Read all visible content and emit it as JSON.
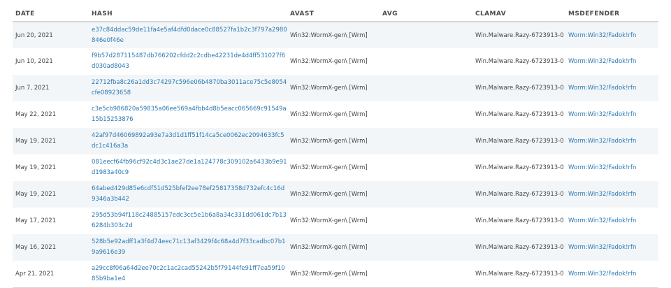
{
  "headers": {
    "date": "DATE",
    "hash": "HASH",
    "avast": "AVAST",
    "avg": "AVG",
    "clamav": "CLAMAV",
    "msdefender": "MSDEFENDER"
  },
  "rows": [
    {
      "date": "Jun 20, 2021",
      "hash": "e37c84ddac59de11fa4e5af4dfd0dace0c88527fa1b2c3f797a2980846e0f46e",
      "avast": "Win32:WormX-gen\\ [Wrm]",
      "avg": "",
      "clamav": "Win.Malware.Razy-6723913-0",
      "msdefender": "Worm:Win32/Fadok!rfn"
    },
    {
      "date": "Jun 10, 2021",
      "hash": "f9b57d287115487db766202cfdd2c2cdbe42231de4d4ff531027f6d030ad8043",
      "avast": "Win32:WormX-gen\\ [Wrm]",
      "avg": "",
      "clamav": "Win.Malware.Razy-6723913-0",
      "msdefender": "Worm:Win32/Fadok!rfn"
    },
    {
      "date": "Jun 7, 2021",
      "hash": "22712fba8c26a1dd3c74297c596e06b4870ba3011ace75c5e8054cfe08923658",
      "avast": "Win32:WormX-gen\\ [Wrm]",
      "avg": "",
      "clamav": "Win.Malware.Razy-6723913-0",
      "msdefender": "Worm:Win32/Fadok!rfn"
    },
    {
      "date": "May 22, 2021",
      "hash": "c3e5cb986820a59835a06ee569a4fbb4d8b5eacc065669c91549a15b15253876",
      "avast": "Win32:WormX-gen\\ [Wrm]",
      "avg": "",
      "clamav": "Win.Malware.Razy-6723913-0",
      "msdefender": "Worm:Win32/Fadok!rfn"
    },
    {
      "date": "May 19, 2021",
      "hash": "42af97d46069892a93e7a3d1d1ff51f14ca5ce0062ec2094633fc5dc1c416a3a",
      "avast": "Win32:WormX-gen\\ [Wrm]",
      "avg": "",
      "clamav": "Win.Malware.Razy-6723913-0",
      "msdefender": "Worm:Win32/Fadok!rfn"
    },
    {
      "date": "May 19, 2021",
      "hash": "081eecf64fb96cf92c4d3c1ae27de1a124778c309102a6433b9e91d1983a40c9",
      "avast": "Win32:WormX-gen\\ [Wrm]",
      "avg": "",
      "clamav": "Win.Malware.Razy-6723913-0",
      "msdefender": "Worm:Win32/Fadok!rfn"
    },
    {
      "date": "May 19, 2021",
      "hash": "64abed429d85e6cdf51d525bfef2ee78ef25817358d732efc4c16d9346a3b442",
      "avast": "Win32:WormX-gen\\ [Wrm]",
      "avg": "",
      "clamav": "Win.Malware.Razy-6723913-0",
      "msdefender": "Worm:Win32/Fadok!rfn"
    },
    {
      "date": "May 17, 2021",
      "hash": "295d53b94f118c24885157edc3cc5e1b6a8a34c331dd061dc7b136284b303c2d",
      "avast": "Win32:WormX-gen\\ [Wrm]",
      "avg": "",
      "clamav": "Win.Malware.Razy-6723913-0",
      "msdefender": "Worm:Win32/Fadok!rfn"
    },
    {
      "date": "May 16, 2021",
      "hash": "528b5e92adff1a3f4d74eec71c13af3429f4c68a4d7f33cadbc07b19a9616e39",
      "avast": "Win32:WormX-gen\\ [Wrm]",
      "avg": "",
      "clamav": "Win.Malware.Razy-6723913-0",
      "msdefender": "Worm:Win32/Fadok!rfn"
    },
    {
      "date": "Apr 21, 2021",
      "hash": "a29cc8f06a64d2ee70c2c1ac2cad55242b5f79144fe91ff7ea59f1085b9ba1e4",
      "avast": "Win32:WormX-gen\\ [Wrm]",
      "avg": "",
      "clamav": "Win.Malware.Razy-6723913-0",
      "msdefender": "Worm:Win32/Fadok!rfn"
    }
  ],
  "colors": {
    "link": "#2a78b4",
    "row_alt": "#f3f6f8"
  }
}
